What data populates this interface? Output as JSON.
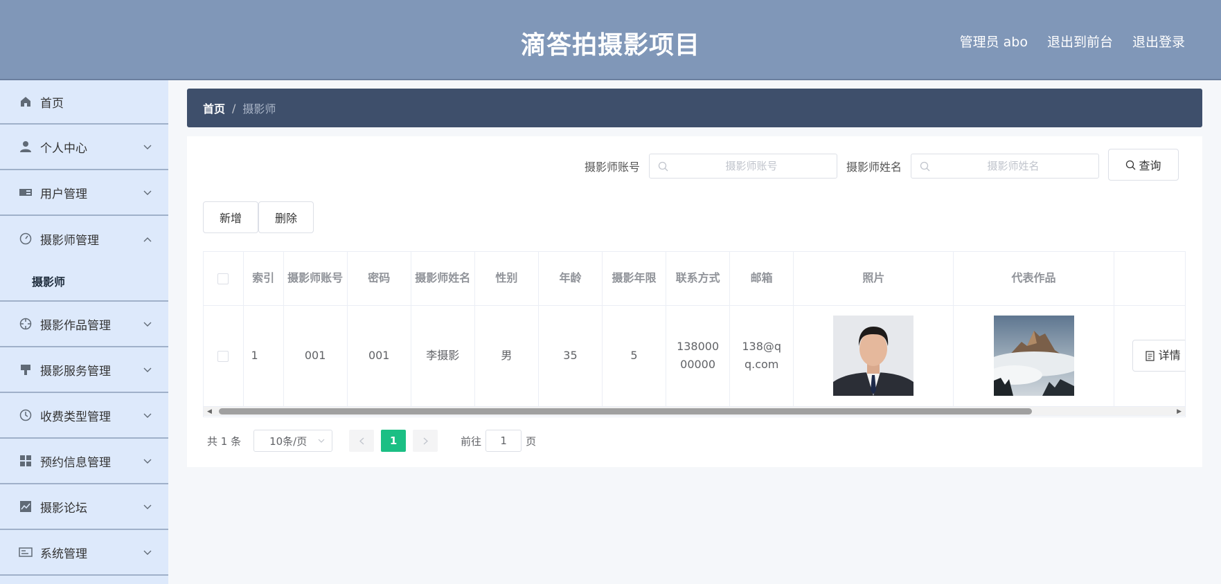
{
  "header": {
    "title": "滴答拍摄影项目",
    "user_label": "管理员 abo",
    "to_front_label": "退出到前台",
    "logout_label": "退出登录"
  },
  "sidebar": {
    "items": [
      {
        "label": "首页",
        "icon": "home-icon"
      },
      {
        "label": "个人中心",
        "icon": "user-icon"
      },
      {
        "label": "用户管理",
        "icon": "ticket-icon"
      },
      {
        "label": "摄影师管理",
        "icon": "dashboard-icon",
        "expanded": true,
        "children": [
          {
            "label": "摄影师"
          }
        ]
      },
      {
        "label": "摄影作品管理",
        "icon": "crosshair-icon"
      },
      {
        "label": "摄影服务管理",
        "icon": "service-icon"
      },
      {
        "label": "收费类型管理",
        "icon": "clock-icon"
      },
      {
        "label": "预约信息管理",
        "icon": "grid-icon"
      },
      {
        "label": "摄影论坛",
        "icon": "chart-icon"
      },
      {
        "label": "系统管理",
        "icon": "card-icon"
      }
    ]
  },
  "breadcrumb": {
    "home": "首页",
    "separator": "/",
    "current": "摄影师"
  },
  "search": {
    "account_label": "摄影师账号",
    "account_placeholder": "摄影师账号",
    "name_label": "摄影师姓名",
    "name_placeholder": "摄影师姓名",
    "query_label": "查询"
  },
  "actions": {
    "add_label": "新增",
    "delete_label": "删除"
  },
  "table": {
    "headers": [
      "",
      "索引",
      "摄影师账号",
      "密码",
      "摄影师姓名",
      "性别",
      "年龄",
      "摄影年限",
      "联系方式",
      "邮箱",
      "照片",
      "代表作品",
      ""
    ],
    "rows": [
      {
        "index": "1",
        "account": "001",
        "password": "001",
        "name": "李摄影",
        "gender": "男",
        "age": "35",
        "years": "5",
        "phone": "13800000000",
        "email": "138@qq.com",
        "detail_label": "详情"
      }
    ]
  },
  "pagination": {
    "total": "共 1 条",
    "page_size": "10条/页",
    "current_page": "1",
    "goto_label": "前往",
    "goto_value": "1",
    "page_suffix": "页"
  }
}
